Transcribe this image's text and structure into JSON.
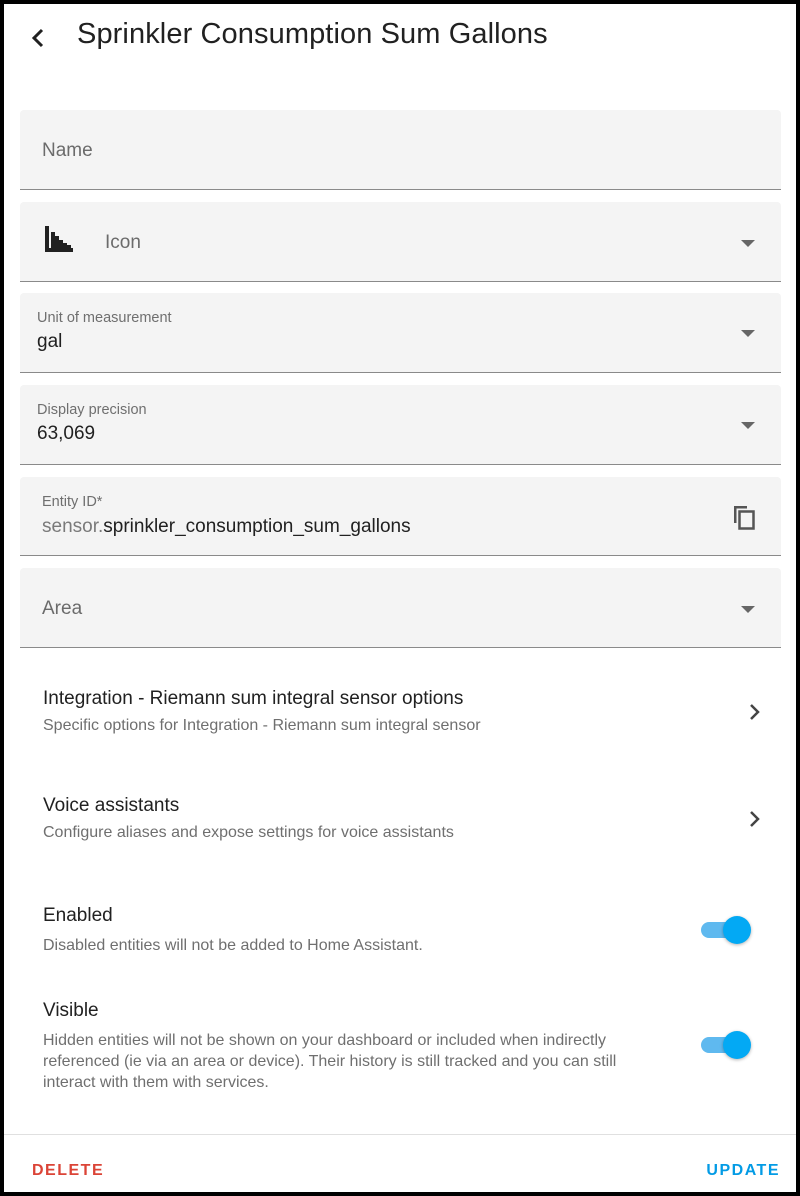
{
  "header": {
    "back_icon": "chevron-left-icon",
    "title": "Sprinkler Consumption Sum Gallons"
  },
  "fields": {
    "name": {
      "placeholder": "Name"
    },
    "icon": {
      "placeholder": "Icon",
      "icon": "chart-bell-curve-cumulative-icon"
    },
    "unit": {
      "label": "Unit of measurement",
      "value": "gal"
    },
    "precision": {
      "label": "Display precision",
      "value": "63,069"
    },
    "entity_id": {
      "label": "Entity ID*",
      "prefix": "sensor.",
      "value": "sprinkler_consumption_sum_gallons",
      "copy_icon": "content-copy-icon"
    },
    "area": {
      "placeholder": "Area"
    }
  },
  "rows": {
    "integration": {
      "title": "Integration - Riemann sum integral sensor options",
      "subtitle": "Specific options for Integration - Riemann sum integral sensor"
    },
    "voice": {
      "title": "Voice assistants",
      "subtitle": "Configure aliases and expose settings for voice assistants"
    }
  },
  "toggles": {
    "enabled": {
      "title": "Enabled",
      "subtitle": "Disabled entities will not be added to Home Assistant.",
      "on": true
    },
    "visible": {
      "title": "Visible",
      "subtitle": "Hidden entities will not be shown on your dashboard or included when indirectly referenced (ie via an area or device). Their history is still tracked and you can still interact with them with services.",
      "on": true
    }
  },
  "footer": {
    "delete_label": "DELETE",
    "update_label": "UPDATE"
  },
  "colors": {
    "accent": "#03a9f4",
    "danger": "#db4437",
    "field_bg": "#f4f4f4"
  }
}
